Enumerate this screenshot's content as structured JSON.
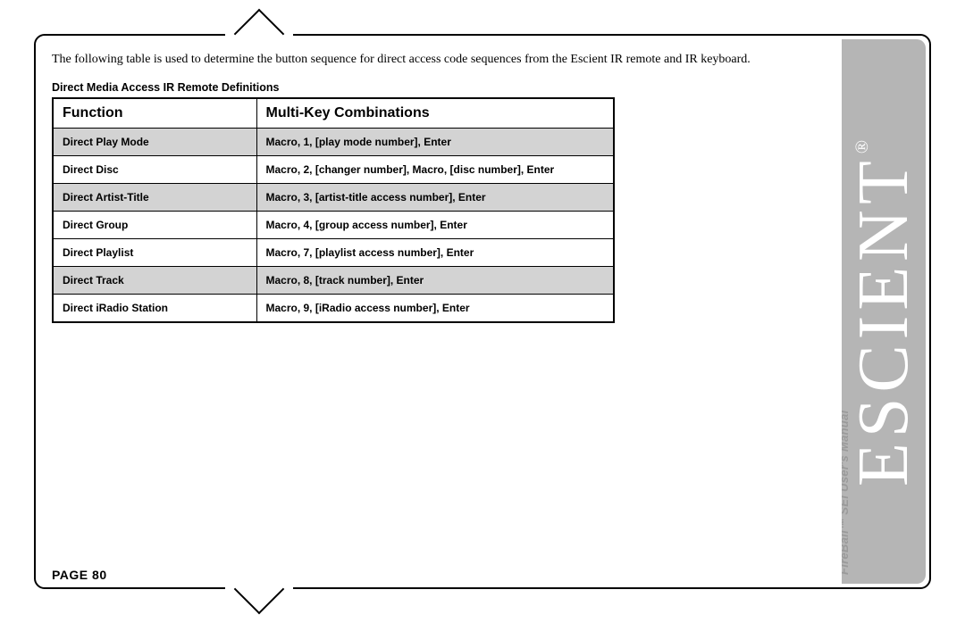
{
  "intro_text": "The following table is used to determine the button sequence for direct access code sequences from the Escient IR remote and IR keyboard.",
  "table_caption": "Direct Media Access IR Remote Definitions",
  "headers": {
    "function": "Function",
    "combinations": "Multi-Key Combinations"
  },
  "rows": [
    {
      "shaded": true,
      "function": "Direct Play Mode",
      "combo": "Macro, 1, [play mode number], Enter"
    },
    {
      "shaded": false,
      "function": "Direct Disc",
      "combo": "Macro, 2, [changer number], Macro, [disc number], Enter"
    },
    {
      "shaded": true,
      "function": "Direct Artist-Title",
      "combo": "Macro, 3, [artist-title access number], Enter"
    },
    {
      "shaded": false,
      "function": "Direct Group",
      "combo": "Macro, 4, [group access number], Enter"
    },
    {
      "shaded": false,
      "function": "Direct Playlist",
      "combo": "Macro, 7, [playlist access number], Enter"
    },
    {
      "shaded": true,
      "function": "Direct Track",
      "combo": "Macro, 8, [track number], Enter"
    },
    {
      "shaded": false,
      "function": "Direct iRadio Station",
      "combo": "Macro, 9, [iRadio access number], Enter"
    }
  ],
  "page_label": "PAGE 80",
  "sidebar": {
    "brand": "ESCIENT",
    "registered": "®",
    "doc_title": "FireBall™ SEi User's Manual"
  }
}
